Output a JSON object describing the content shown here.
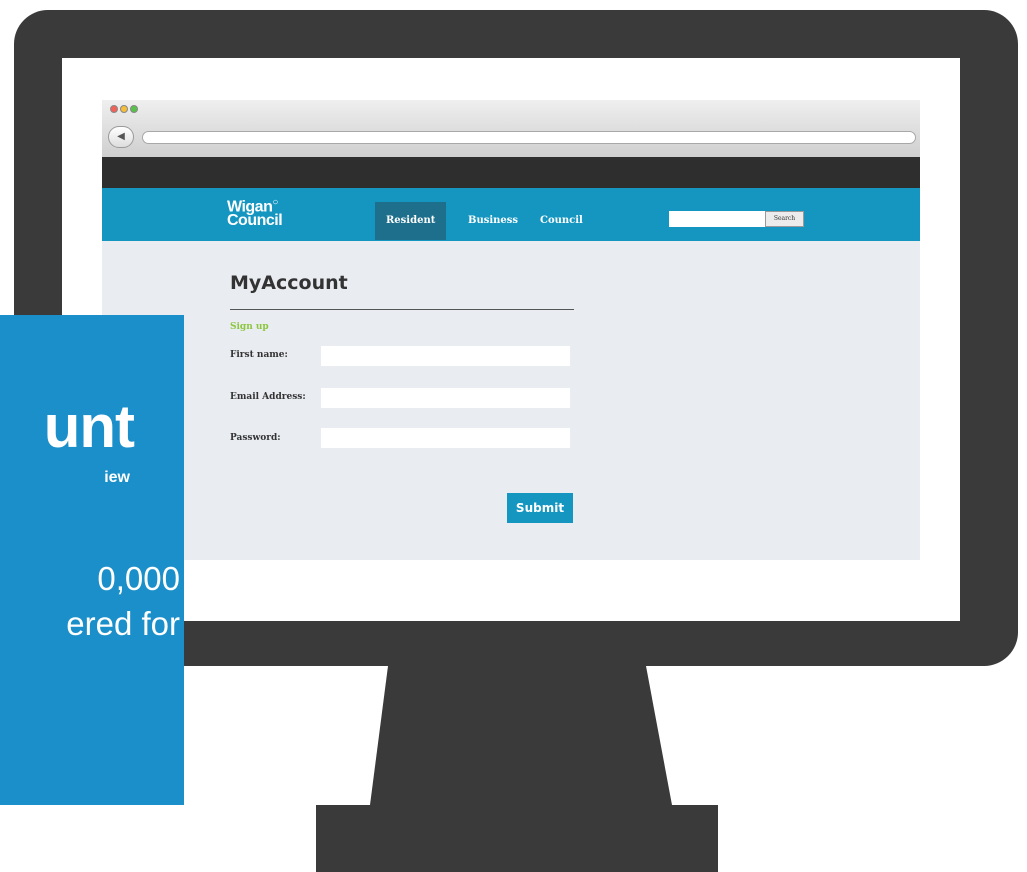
{
  "browser": {
    "traffic_lights": [
      "close",
      "minimize",
      "zoom"
    ],
    "back_icon": "◀"
  },
  "site": {
    "logo_line1": "Wigan",
    "logo_line2": "Council",
    "nav": [
      {
        "label": "Resident",
        "active": true
      },
      {
        "label": "Business",
        "active": false
      },
      {
        "label": "Council",
        "active": false
      }
    ],
    "search_button": "Search"
  },
  "page": {
    "title": "MyAccount",
    "subtitle": "Sign up",
    "fields": [
      {
        "label": "First name:",
        "value": ""
      },
      {
        "label": "Email Address:",
        "value": ""
      },
      {
        "label": "Password:",
        "value": ""
      }
    ],
    "submit_label": "Submit"
  },
  "promo": {
    "heading_fragment": "unt",
    "sub_fragment": "iew",
    "line1_fragment": "0,000",
    "line2_fragment": "ered for"
  },
  "colors": {
    "monitor": "#3a3a3a",
    "nav_blue": "#1496c0",
    "nav_active": "#1d6f8c",
    "signup_green": "#8dc63f",
    "promo_blue": "#1a8fc9"
  }
}
